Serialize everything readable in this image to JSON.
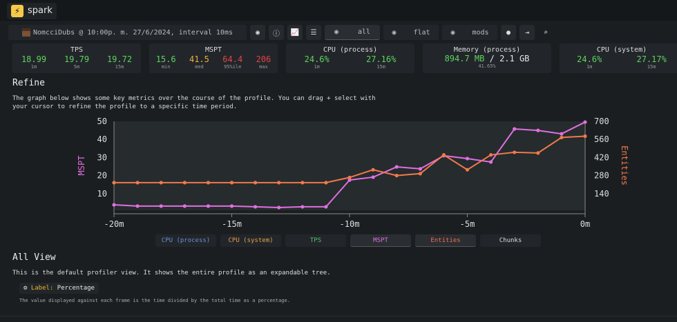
{
  "app": {
    "name": "spark"
  },
  "toolbar": {
    "meta": "NomcciDubs @ 10:00p. m. 27/6/2024, interval 10ms",
    "views": [
      "all",
      "flat",
      "mods"
    ]
  },
  "stats": {
    "tps": {
      "title": "TPS",
      "values": [
        {
          "v": "18.99",
          "l": "1m"
        },
        {
          "v": "19.79",
          "l": "5m"
        },
        {
          "v": "19.72",
          "l": "15m"
        }
      ]
    },
    "mspt": {
      "title": "MSPT",
      "values": [
        {
          "v": "15.6",
          "l": "min"
        },
        {
          "v": "41.5",
          "l": "med"
        },
        {
          "v": "64.4",
          "l": "95%ile"
        },
        {
          "v": "206",
          "l": "max"
        }
      ]
    },
    "cpu_process": {
      "title": "CPU (process)",
      "values": [
        {
          "v": "24.6%",
          "l": "1m"
        },
        {
          "v": "27.16%",
          "l": "15m"
        }
      ]
    },
    "memory": {
      "title": "Memory (process)",
      "used": "894.7 MB",
      "sep": "/",
      "total": "2.1 GB",
      "pct": "41.65%"
    },
    "cpu_system": {
      "title": "CPU (system)",
      "values": [
        {
          "v": "24.6%",
          "l": "1m"
        },
        {
          "v": "27.17%",
          "l": "15m"
        }
      ]
    }
  },
  "refine": {
    "title": "Refine",
    "text": "The graph below shows some key metrics over the course of the profile. You can drag + select with your cursor to refine the profile to a specific time period."
  },
  "legend": [
    {
      "label": "CPU (process)",
      "color": "#6b8fd6"
    },
    {
      "label": "CPU (system)",
      "color": "#e8a04a"
    },
    {
      "label": "TPS",
      "color": "#4fc46b"
    },
    {
      "label": "MSPT",
      "color": "#e070e0"
    },
    {
      "label": "Entities",
      "color": "#f07050"
    },
    {
      "label": "Chunks",
      "color": "#dddddd"
    }
  ],
  "chart_data": {
    "type": "line",
    "x": [
      -20,
      -19,
      -18,
      -17,
      -16,
      -15,
      -14,
      -13,
      -12,
      -11,
      -10,
      -9,
      -8,
      -7,
      -6,
      -5,
      -4,
      -3,
      -2,
      -1,
      0
    ],
    "xticks": [
      "-20m",
      "-15m",
      "-10m",
      "-5m",
      "0m"
    ],
    "xlim": [
      -20,
      0
    ],
    "ylabel_left": "MSPT",
    "ylim_left": [
      0,
      50
    ],
    "yticks_left": [
      "10",
      "20",
      "30",
      "40",
      "50"
    ],
    "ylabel_right": "Entities",
    "ylim_right": [
      0,
      700
    ],
    "yticks_right": [
      "140",
      "280",
      "420",
      "560",
      "700"
    ],
    "series": [
      {
        "name": "MSPT",
        "axis": "left",
        "color": "#e070e0",
        "values": [
          3.8,
          3.1,
          3.1,
          3.1,
          3.1,
          3.1,
          2.7,
          2.3,
          2.7,
          2.7,
          17.5,
          19.1,
          24.8,
          23.7,
          31,
          29.4,
          27.5,
          45.8,
          45,
          43.1,
          49.6
        ]
      },
      {
        "name": "Entities",
        "axis": "right",
        "color": "#f07a4a",
        "values": [
          225,
          225,
          225,
          225,
          225,
          225,
          225,
          225,
          225,
          225,
          265,
          325,
          280,
          295,
          440,
          325,
          440,
          460,
          455,
          575,
          585
        ]
      }
    ]
  },
  "allview": {
    "title": "All View",
    "text": "This is the default profiler view. It shows the entire profile as an expandable tree.",
    "label_key": "Label:",
    "label_val": "Percentage",
    "note": "The value displayed against each frame is the time divided by the total time as a percentage."
  }
}
